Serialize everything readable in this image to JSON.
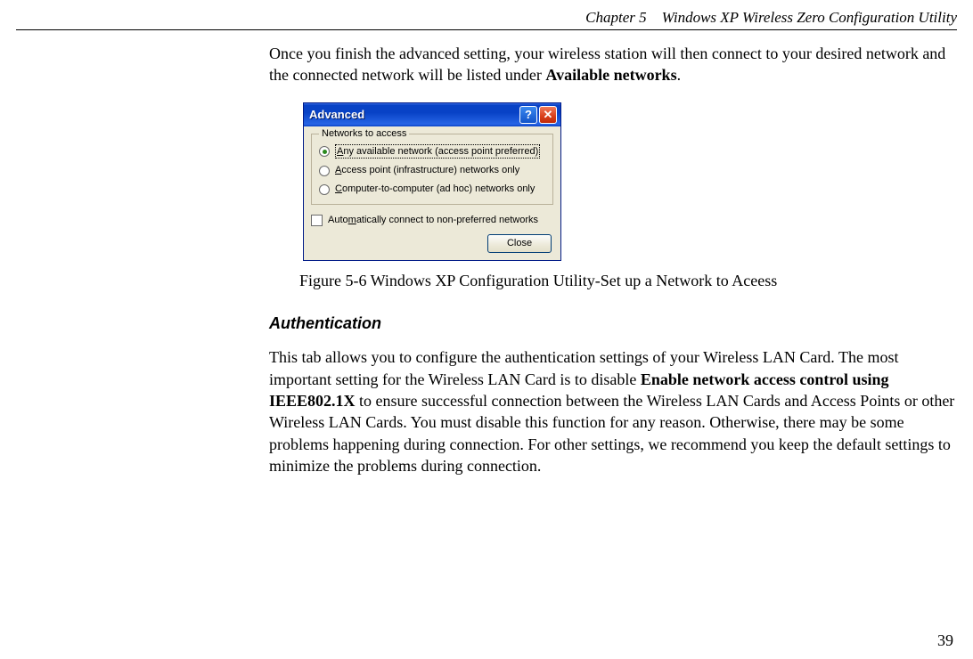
{
  "header": {
    "chapter": "Chapter 5",
    "title": "Windows XP Wireless Zero Configuration Utility"
  },
  "intro": {
    "text_a": "Once you finish the advanced setting, your wireless station will then connect to your desired network and the connected network will be listed under ",
    "bold": "Available networks",
    "text_b": "."
  },
  "dialog": {
    "title": "Advanced",
    "help_glyph": "?",
    "close_glyph": "✕",
    "group_legend": "Networks to access",
    "option1_pre": "A",
    "option1_rest": "ny available network (access point preferred)",
    "option2_pre": "A",
    "option2_rest": "ccess point (infrastructure) networks only",
    "option3_pre": "C",
    "option3_rest": "omputer-to-computer (ad hoc) networks only",
    "checkbox_pre": "Auto",
    "checkbox_u": "m",
    "checkbox_rest": "atically connect to non-preferred networks",
    "close_button": "Close"
  },
  "figure_caption": "Figure 5-6    Windows XP Configuration Utility-Set up a Network to Aceess",
  "section_heading": "Authentication",
  "auth_para": {
    "a": "This tab allows you to configure the authentication settings of your Wireless LAN Card. The most important setting for the Wireless LAN Card is to disable ",
    "b": "Enable network access control using IEEE802.1X",
    "c": " to ensure successful connection between the Wireless LAN Cards and Access Points or other Wireless LAN Cards. You must disable this function for any reason. Otherwise, there may be some problems happening during connection. For other settings, we recommend you keep the default settings to minimize the problems during connection."
  },
  "page_number": "39"
}
